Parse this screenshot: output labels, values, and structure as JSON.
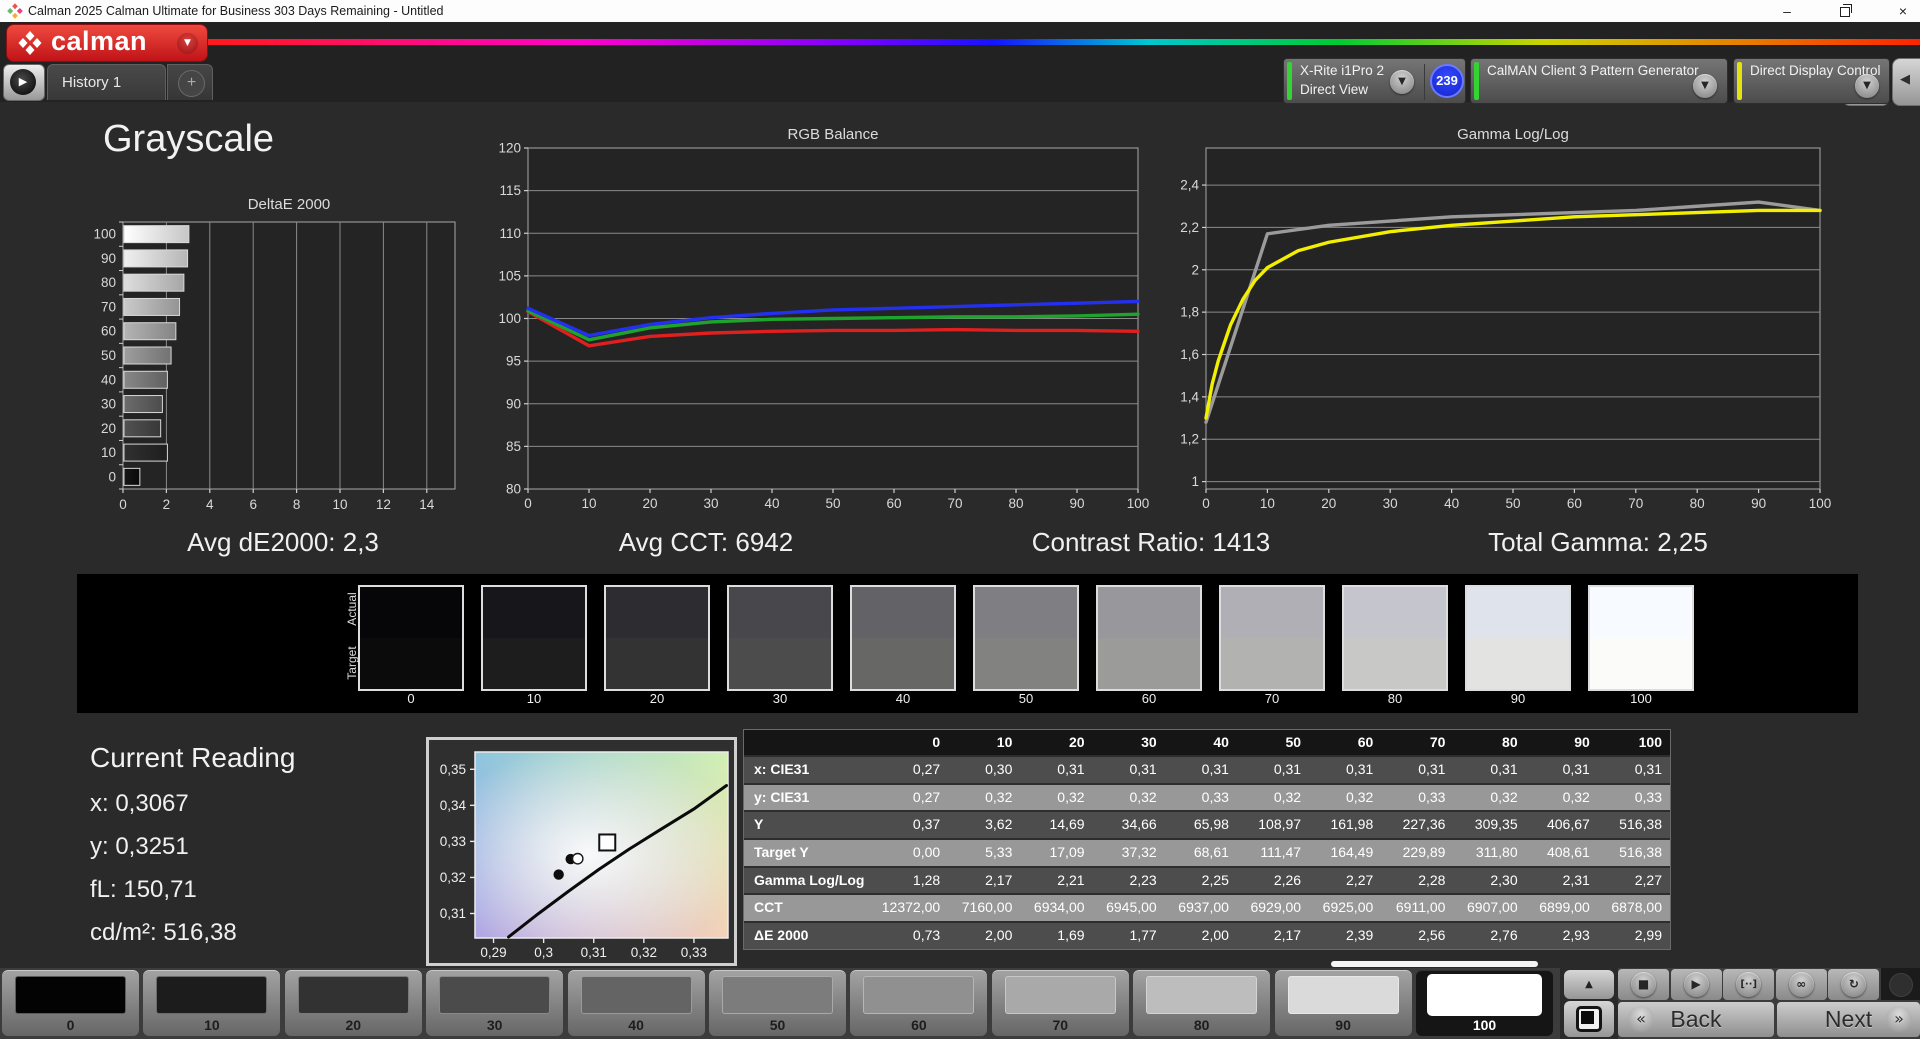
{
  "titlebar": {
    "title": "Calman 2025 Calman Ultimate for Business 303 Days Remaining  - Untitled"
  },
  "header": {
    "logo": {
      "text": "calman"
    },
    "tabs": {
      "items": [
        {
          "label": "History 1"
        }
      ],
      "add_label": "+"
    },
    "devices": [
      {
        "lines": [
          "X-Rite i1Pro 2",
          "Direct View"
        ],
        "accent": "#35d435",
        "badge": "239"
      },
      {
        "lines": [
          "CalMAN Client 3 Pattern Generator"
        ],
        "accent": "#35d435"
      },
      {
        "lines": [
          "Direct Display Control"
        ],
        "accent": "#e3e312"
      }
    ]
  },
  "page_title": "Grayscale",
  "stats": [
    "Avg dE2000: 2,3",
    "Avg CCT: 6942",
    "Contrast Ratio: 1413",
    "Total Gamma: 2,25"
  ],
  "chart_data": {
    "deltae": {
      "type": "bar",
      "title": "DeltaE 2000",
      "orientation": "horizontal",
      "categories": [
        "100",
        "90",
        "80",
        "70",
        "60",
        "50",
        "40",
        "30",
        "20",
        "10",
        "0"
      ],
      "values": [
        2.99,
        2.93,
        2.76,
        2.56,
        2.39,
        2.17,
        2.0,
        1.77,
        1.69,
        2.0,
        0.73
      ],
      "bar_gradients": [
        [
          "#ffffff",
          "#c6c6c6"
        ],
        [
          "#f0f0f0",
          "#b6b6b6"
        ],
        [
          "#dedede",
          "#a6a6a6"
        ],
        [
          "#cacaca",
          "#949494"
        ],
        [
          "#b4b4b4",
          "#848484"
        ],
        [
          "#9e9e9e",
          "#727272"
        ],
        [
          "#888888",
          "#606060"
        ],
        [
          "#6c6c6c",
          "#4c4c4c"
        ],
        [
          "#525252",
          "#383838"
        ],
        [
          "#303030",
          "#1e1e1e"
        ],
        [
          "#161616",
          "#090909"
        ]
      ],
      "xlim": [
        0,
        15.3
      ],
      "xticks": [
        0,
        2,
        4,
        6,
        8,
        10,
        12,
        14
      ],
      "xtick_labels": [
        "0",
        "2",
        "4",
        "6",
        "8",
        "10",
        "12",
        "14"
      ]
    },
    "rgb_balance": {
      "type": "line",
      "title": "RGB Balance",
      "x": [
        0,
        10,
        20,
        30,
        40,
        50,
        60,
        70,
        80,
        90,
        100
      ],
      "xticks": [
        0,
        10,
        20,
        30,
        40,
        50,
        60,
        70,
        80,
        90,
        100
      ],
      "xtick_labels": [
        "0",
        "10",
        "20",
        "30",
        "40",
        "50",
        "60",
        "70",
        "80",
        "90",
        "100"
      ],
      "ylim": [
        80,
        120
      ],
      "yticks": [
        80,
        85,
        90,
        95,
        100,
        105,
        110,
        115,
        120
      ],
      "ytick_labels": [
        "80",
        "85",
        "90",
        "95",
        "100",
        "105",
        "110",
        "115",
        "120"
      ],
      "series": [
        {
          "name": "red",
          "color": "#e01f1f",
          "values": [
            100.8,
            96.8,
            97.9,
            98.3,
            98.5,
            98.6,
            98.6,
            98.7,
            98.6,
            98.6,
            98.5
          ]
        },
        {
          "name": "green",
          "color": "#1ea32c",
          "values": [
            100.9,
            97.5,
            98.9,
            99.6,
            99.9,
            100.0,
            100.1,
            100.2,
            100.2,
            100.3,
            100.5
          ]
        },
        {
          "name": "blue",
          "color": "#2430ef",
          "values": [
            101.2,
            98.0,
            99.3,
            100.1,
            100.6,
            101.0,
            101.2,
            101.4,
            101.6,
            101.8,
            102.0
          ]
        }
      ]
    },
    "gamma": {
      "type": "line",
      "title": "Gamma Log/Log",
      "xticks": [
        0,
        10,
        20,
        30,
        40,
        50,
        60,
        70,
        80,
        90,
        100
      ],
      "xtick_labels": [
        "0",
        "10",
        "20",
        "30",
        "40",
        "50",
        "60",
        "70",
        "80",
        "90",
        "100"
      ],
      "ylim": [
        0.965,
        2.575
      ],
      "yticks": [
        1,
        1.2,
        1.4,
        1.6,
        1.8,
        2,
        2.2,
        2.4
      ],
      "ytick_labels": [
        "1",
        "1,2",
        "1,4",
        "1,6",
        "1,8",
        "2",
        "2,2",
        "2,4"
      ],
      "series": [
        {
          "name": "reference",
          "color": "#9b9b9b",
          "x": [
            0,
            10,
            20,
            30,
            40,
            50,
            60,
            70,
            80,
            90,
            100
          ],
          "values": [
            1.28,
            2.17,
            2.21,
            2.23,
            2.25,
            2.26,
            2.27,
            2.28,
            2.3,
            2.32,
            2.28
          ]
        },
        {
          "name": "measured",
          "color": "#f2ef00",
          "x": [
            0,
            1,
            2,
            4,
            6,
            8,
            10,
            15,
            20,
            30,
            40,
            50,
            60,
            70,
            80,
            90,
            100
          ],
          "values": [
            1.3,
            1.46,
            1.57,
            1.74,
            1.86,
            1.95,
            2.01,
            2.09,
            2.13,
            2.18,
            2.21,
            2.23,
            2.25,
            2.26,
            2.27,
            2.28,
            2.28
          ]
        }
      ]
    },
    "cie": {
      "type": "scatter",
      "xlim": [
        0.2863,
        0.3368
      ],
      "ylim": [
        0.3032,
        0.3548
      ],
      "xticks": [
        0.29,
        0.3,
        0.31,
        0.32,
        0.33
      ],
      "xtick_labels": [
        "0,29",
        "0,3",
        "0,31",
        "0,32",
        "0,33"
      ],
      "yticks": [
        0.31,
        0.32,
        0.33,
        0.34,
        0.35
      ],
      "ytick_labels": [
        "0,31",
        "0,32",
        "0,33",
        "0,34",
        "0,35"
      ],
      "locus": [
        [
          0.293,
          0.3035
        ],
        [
          0.299,
          0.31
        ],
        [
          0.305,
          0.3162
        ],
        [
          0.311,
          0.3222
        ],
        [
          0.317,
          0.3278
        ],
        [
          0.323,
          0.333
        ],
        [
          0.33,
          0.339
        ],
        [
          0.3365,
          0.3455
        ]
      ],
      "points": [
        {
          "x": 0.303,
          "y": 0.3208,
          "style": "black-dot"
        },
        {
          "x": 0.3054,
          "y": 0.3251,
          "style": "black-dot"
        },
        {
          "x": 0.3068,
          "y": 0.3252,
          "style": "white-dot"
        }
      ],
      "target": {
        "x": 0.3127,
        "y": 0.3297,
        "style": "square"
      }
    }
  },
  "swatches": {
    "row_labels": [
      "Actual",
      "Target"
    ],
    "levels": [
      "0",
      "10",
      "20",
      "30",
      "40",
      "50",
      "60",
      "70",
      "80",
      "90",
      "100"
    ],
    "actual": [
      "#060609",
      "#17171b",
      "#2d2d31",
      "#48484c",
      "#636367",
      "#7f7f83",
      "#98989c",
      "#afafb5",
      "#c5c5cd",
      "#dfe3eb",
      "#f7fafe"
    ],
    "target": [
      "#0b0b0b",
      "#1d1d1d",
      "#333333",
      "#4c4c4c",
      "#676765",
      "#828280",
      "#9b9b99",
      "#b2b2b0",
      "#c8c8c6",
      "#e3e3e1",
      "#fbfbf9"
    ]
  },
  "current_reading": {
    "title": "Current Reading",
    "lines": [
      "x: 0,3067",
      "y: 0,3251",
      "fL: 150,71",
      "cd/m²: 516,38"
    ]
  },
  "table": {
    "columns": [
      "0",
      "10",
      "20",
      "30",
      "40",
      "50",
      "60",
      "70",
      "80",
      "90",
      "100"
    ],
    "rows": [
      {
        "label": "x: CIE31",
        "values": [
          "0,27",
          "0,30",
          "0,31",
          "0,31",
          "0,31",
          "0,31",
          "0,31",
          "0,31",
          "0,31",
          "0,31",
          "0,31"
        ]
      },
      {
        "label": "y: CIE31",
        "values": [
          "0,27",
          "0,32",
          "0,32",
          "0,32",
          "0,33",
          "0,32",
          "0,32",
          "0,33",
          "0,32",
          "0,32",
          "0,33"
        ]
      },
      {
        "label": "Y",
        "values": [
          "0,37",
          "3,62",
          "14,69",
          "34,66",
          "65,98",
          "108,97",
          "161,98",
          "227,36",
          "309,35",
          "406,67",
          "516,38"
        ]
      },
      {
        "label": "Target Y",
        "values": [
          "0,00",
          "5,33",
          "17,09",
          "37,32",
          "68,61",
          "111,47",
          "164,49",
          "229,89",
          "311,80",
          "408,61",
          "516,38"
        ]
      },
      {
        "label": "Gamma Log/Log",
        "values": [
          "1,28",
          "2,17",
          "2,21",
          "2,23",
          "2,25",
          "2,26",
          "2,27",
          "2,28",
          "2,30",
          "2,31",
          "2,27"
        ]
      },
      {
        "label": "CCT",
        "values": [
          "12372,00",
          "7160,00",
          "6934,00",
          "6945,00",
          "6937,00",
          "6929,00",
          "6925,00",
          "6911,00",
          "6907,00",
          "6899,00",
          "6878,00"
        ]
      },
      {
        "label": "ΔE 2000",
        "values": [
          "0,73",
          "2,00",
          "1,69",
          "1,77",
          "2,00",
          "2,17",
          "2,39",
          "2,56",
          "2,76",
          "2,93",
          "2,99"
        ]
      }
    ]
  },
  "bottom": {
    "tiles": [
      {
        "label": "0",
        "color": "#030303"
      },
      {
        "label": "10",
        "color": "#1c1c1c"
      },
      {
        "label": "20",
        "color": "#323232"
      },
      {
        "label": "30",
        "color": "#4b4b4b"
      },
      {
        "label": "40",
        "color": "#646464"
      },
      {
        "label": "50",
        "color": "#7c7c7c"
      },
      {
        "label": "60",
        "color": "#909090"
      },
      {
        "label": "70",
        "color": "#a9a9a9"
      },
      {
        "label": "80",
        "color": "#bdbdbd"
      },
      {
        "label": "90",
        "color": "#dadada"
      },
      {
        "label": "100",
        "color": "#ffffff"
      }
    ],
    "selected_tile": "100",
    "transport": [
      {
        "name": "stop",
        "glyph": "■"
      },
      {
        "name": "play",
        "glyph": "▶"
      },
      {
        "name": "measure",
        "glyph": "[··]"
      },
      {
        "name": "continuous",
        "glyph": "∞"
      },
      {
        "name": "refresh",
        "glyph": "↻"
      }
    ],
    "pattern_up_glyph": "▲",
    "back_glyph": "«",
    "next_glyph": "»",
    "back_label": "Back",
    "next_label": "Next"
  }
}
